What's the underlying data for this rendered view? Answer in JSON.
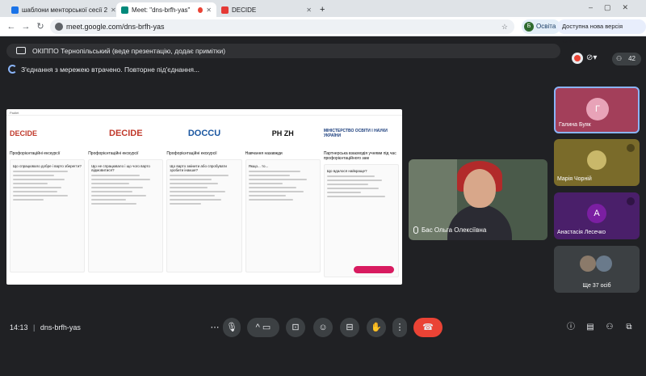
{
  "tabs": [
    {
      "label": "шаблони менторської сесії 2",
      "color": "#1a73e8",
      "active": false
    },
    {
      "label": "Meet: \"dns-brfh-yas\"",
      "color": "#00897b",
      "active": true
    },
    {
      "label": "DECIDE",
      "color": "#e53935",
      "active": false
    }
  ],
  "browser": {
    "url": "meet.google.com/dns-brfh-yas",
    "profile_initial": "Б",
    "profile_label": "Освіта",
    "update_label": "Доступна нова версія Chrome"
  },
  "banner": {
    "text": "ОКІППО Тернопільський (веде презентацію, додає примітки)"
  },
  "reconnect": {
    "text": "З'єднання з мережею втрачено. Повторне під'єднання..."
  },
  "participants_count": "42",
  "slide": {
    "brand": "Padlet",
    "logos": [
      "DECIDE",
      "DOCCU",
      "PH ZH",
      "МІНІСТЕРСТВО ОСВІТИ І НАУКИ УКРАЇНИ"
    ],
    "columns": [
      {
        "title": "Профорієнтаційні екскурсії",
        "question": "Що спрацювало добре і варто зберегти?"
      },
      {
        "title": "Профорієнтаційні екскурсії",
        "question": "Що не спрацювало і що чого варто відмовитися?"
      },
      {
        "title": "Профорієнтаційні екскурсії",
        "question": "Що варто змінити або спробувати зробити інакше?"
      },
      {
        "title": "Навчання назавжди",
        "question": "Якщо... то..."
      },
      {
        "title": "Партнерська взаємодія учнями під час профорієнтаційного зам",
        "question": "Що вдалося найкраще?"
      }
    ]
  },
  "tiles": {
    "main": {
      "name": "Бас Ольга Олексіївна"
    },
    "p1": {
      "name": "Галина Буяк",
      "initial": "Г",
      "color": "#e8a3b8"
    },
    "p2": {
      "name": "Марія Чорній"
    },
    "p3": {
      "name": "Анастасія Лесечко",
      "initial": "А",
      "color": "#7b1fa2"
    },
    "more": {
      "label": "Ще 37 осіб"
    }
  },
  "toolbar": {
    "time": "14:13",
    "code": "dns-brfh-yas"
  }
}
